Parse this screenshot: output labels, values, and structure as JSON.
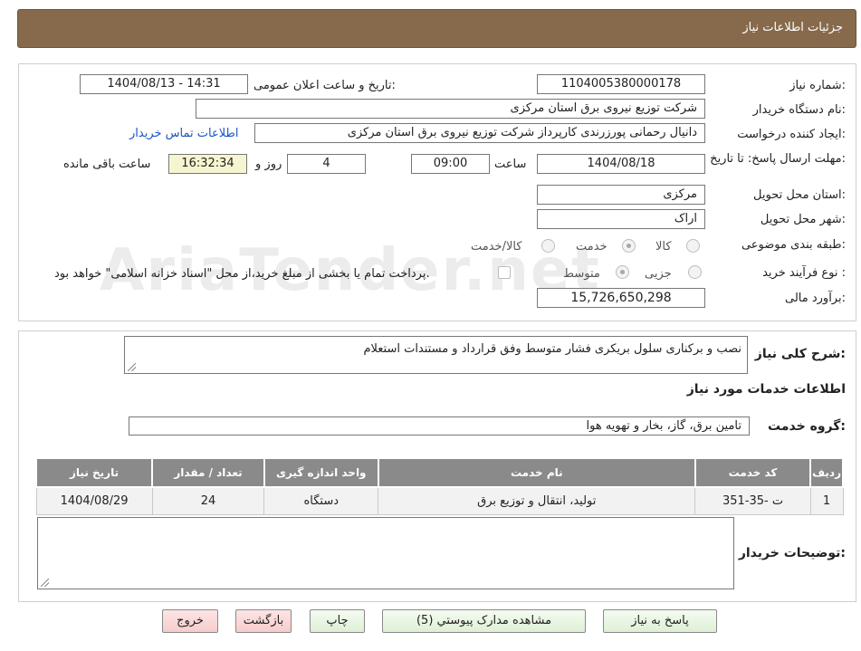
{
  "header": {
    "title": "جزئیات اطلاعات نیاز"
  },
  "watermark": {
    "text": "AriaTender.net"
  },
  "info": {
    "need_number_label": "شماره نیاز:",
    "need_number": "1104005380000178",
    "announce_label": "تاریخ و ساعت اعلان عمومی:",
    "announce_value": "1404/08/13 - 14:31",
    "buyer_org_label": "نام دستگاه خریدار:",
    "buyer_org": "شرکت توزیع نیروی برق استان مرکزی",
    "creator_label": "ایجاد کننده درخواست:",
    "creator": "دانیال رحمانی پورزرندی کارپرداز شرکت توزیع نیروی برق استان مرکزی",
    "contact_link": "اطلاعات تماس خریدار",
    "deadline_label": "مهلت ارسال پاسخ: تا تاریخ:",
    "deadline_date": "1404/08/18",
    "time_label": "ساعت",
    "deadline_time": "09:00",
    "days_value": "4",
    "days_label": "روز و",
    "remaining_time": "16:32:34",
    "remaining_label": "ساعت باقی مانده",
    "province_label": "استان محل تحویل:",
    "province": "مرکزی",
    "city_label": "شهر محل تحویل:",
    "city": "اراک",
    "category_label": "طبقه بندی موضوعی:",
    "category_options": {
      "goods": "کالا",
      "service": "خدمت",
      "goods_service": "کالا/خدمت"
    },
    "process_label": "نوع فرآیند خرید :",
    "process_options": {
      "partial": "جزیی",
      "medium": "متوسط"
    },
    "payment_note": "پرداخت تمام یا بخشی از مبلغ خرید،از محل \"اسناد خزانه اسلامی\" خواهد بود.",
    "budget_label": "برآورد مالی:",
    "budget": "15,726,650,298"
  },
  "description": {
    "label": "شرح کلی نیاز:",
    "text": "نصب و برکناری سلول بریکری فشار متوسط وفق قرارداد و مستندات استعلام"
  },
  "services": {
    "section_title": "اطلاعات خدمات مورد نیاز",
    "group_label": "گروه خدمت:",
    "group_value": "تامین برق، گاز، بخار و تهویه هوا",
    "columns": [
      "ردیف",
      "کد خدمت",
      "نام خدمت",
      "واحد اندازه گیری",
      "تعداد / مقدار",
      "تاریخ نیاز"
    ],
    "rows": [
      {
        "row": "1",
        "code": "ت -35-351",
        "name": "تولید، انتقال و توزیع برق",
        "unit": "دستگاه",
        "qty": "24",
        "date": "1404/08/29"
      }
    ]
  },
  "buyer_notes": {
    "label": "توضیحات خریدار:",
    "value": ""
  },
  "buttons": {
    "reply": "پاسخ به نیاز",
    "attachments": "مشاهده مدارک پیوستي (5)",
    "print": "چاپ",
    "back": "بازگشت",
    "exit": "خروج"
  }
}
